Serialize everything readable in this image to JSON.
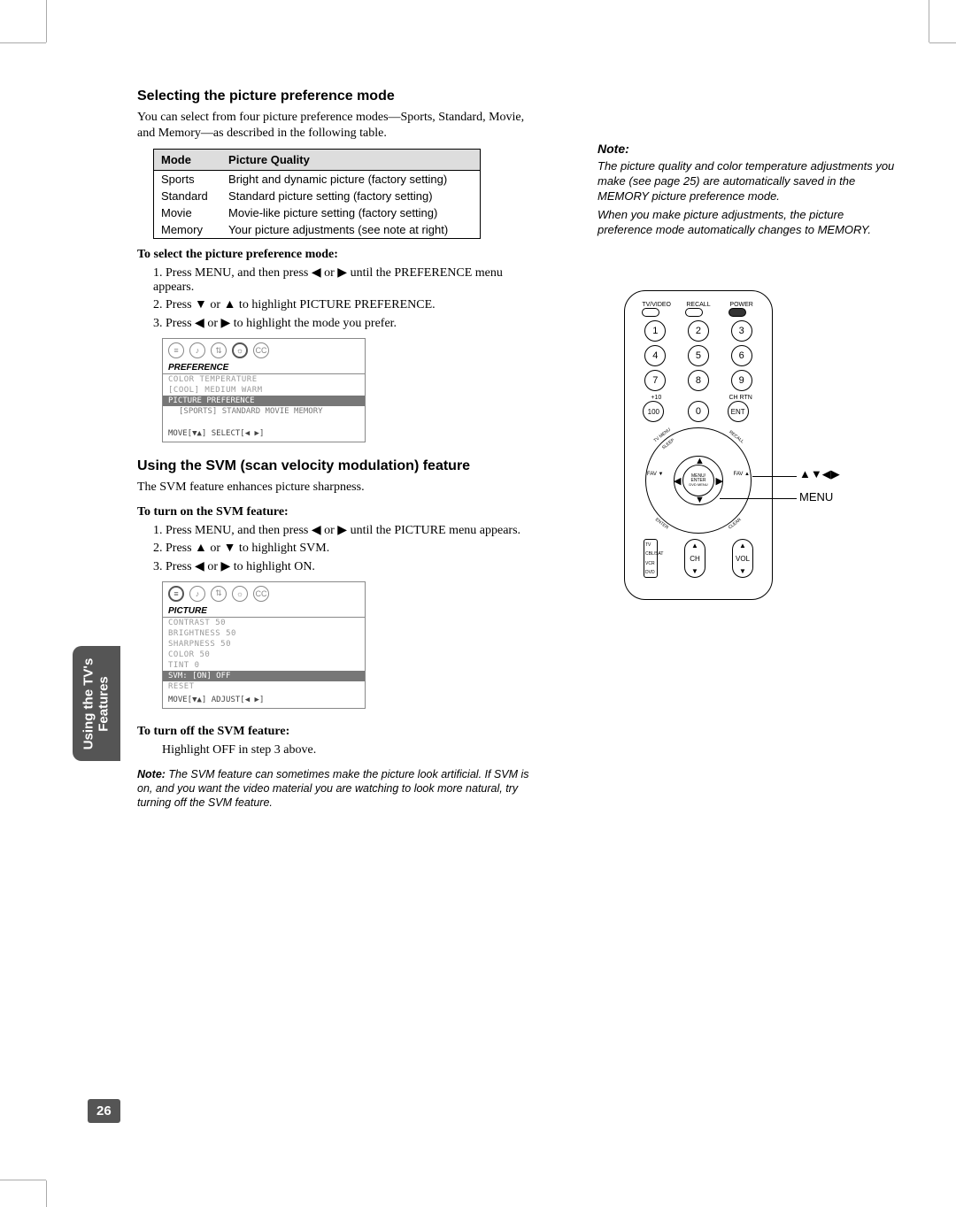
{
  "section1": {
    "title": "Selecting the picture preference mode",
    "intro": "You can select from four picture preference modes—Sports, Standard, Movie, and Memory—as described in the following table.",
    "table": {
      "headers": [
        "Mode",
        "Picture Quality"
      ],
      "rows": [
        [
          "Sports",
          "Bright and dynamic picture (factory setting)"
        ],
        [
          "Standard",
          "Standard picture setting (factory setting)"
        ],
        [
          "Movie",
          "Movie-like picture setting (factory setting)"
        ],
        [
          "Memory",
          "Your picture adjustments (see note at right)"
        ]
      ]
    },
    "procTitle": "To select the picture preference mode:",
    "steps": [
      "Press MENU, and then press ◀ or ▶ until the PREFERENCE menu appears.",
      "Press ▼ or ▲ to highlight PICTURE PREFERENCE.",
      "Press ◀ or ▶ to highlight the mode you prefer."
    ],
    "osd": {
      "tab": "PREFERENCE",
      "row1": "COLOR TEMPERATURE",
      "row1b": "     [COOL] MEDIUM WARM",
      "hl": "PICTURE PREFERENCE",
      "hlb": "[SPORTS] STANDARD  MOVIE  MEMORY",
      "foot": "MOVE[▼▲]   SELECT[◀ ▶]"
    }
  },
  "section2": {
    "title": "Using the SVM (scan velocity modulation) feature",
    "intro": "The SVM feature enhances picture sharpness.",
    "procTitle": "To turn on the SVM feature:",
    "steps": [
      "Press MENU, and then press ◀ or ▶ until the PICTURE menu appears.",
      "Press ▲ or ▼ to highlight SVM.",
      "Press ◀ or ▶ to highlight ON."
    ],
    "osd": {
      "tab": "PICTURE",
      "rows": [
        "CONTRAST     50",
        "BRIGHTNESS   50",
        "SHARPNESS    50",
        "COLOR        50",
        "TINT          0"
      ],
      "hl": "SVM: [ON] OFF",
      "row2": "RESET",
      "foot": "MOVE[▼▲]   ADJUST[◀ ▶]"
    },
    "procTitle2": "To turn off the SVM feature:",
    "step2": "Highlight OFF in step 3 above.",
    "footnote": "The SVM feature can sometimes make the picture look artificial. If SVM is on, and you want the video material you are watching to look more natural, try turning off the SVM feature.",
    "footnoteLabel": "Note: "
  },
  "note": {
    "title": "Note:",
    "p1": "The picture quality and color temperature adjustments you make (see page 25) are automatically saved in the MEMORY picture preference mode.",
    "p2": "When you make picture adjustments, the picture preference mode automatically changes to MEMORY."
  },
  "remote": {
    "topLabels": [
      "TV/VIDEO",
      "RECALL",
      "POWER"
    ],
    "numpad": [
      "1",
      "2",
      "3",
      "4",
      "5",
      "6",
      "7",
      "8",
      "9",
      "100",
      "0",
      "ENT"
    ],
    "plus10": "+10",
    "chrtn": "CH RTN",
    "dpad": {
      "center1": "MENU/",
      "center2": "ENTER",
      "center3": "DVD MENU"
    },
    "favL": "FAV ▼",
    "favR": "FAV ▲",
    "diag": {
      "tl": "TV MENU",
      "tr": "RECALL",
      "bl": "ENTER",
      "br": "CLEAR",
      "tl2": "SLEEP"
    },
    "callout1": "▲▼◀▶",
    "callout2": "MENU",
    "mode": [
      "TV",
      "CBL/SAT",
      "VCR",
      "DVD"
    ],
    "ch": "CH",
    "vol": "VOL"
  },
  "sideTab": {
    "line1": "Using the TV's",
    "line2": "Features"
  },
  "pageNum": "26"
}
